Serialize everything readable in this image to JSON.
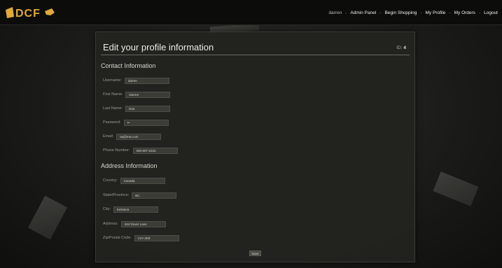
{
  "navbar": {
    "logo_text": "DCF",
    "user": "darren",
    "links": [
      "Admin Panel",
      "Begin Shopping",
      "My Profile",
      "My Orders",
      "Logout"
    ]
  },
  "panel": {
    "title": "Edit your profile information",
    "id_label": "ID:",
    "id_value": "4"
  },
  "contact": {
    "heading": "Contact Information",
    "fields": [
      {
        "label": "Username:",
        "value": "darren"
      },
      {
        "label": "First Name:",
        "value": "Darren"
      },
      {
        "label": "Last Name:",
        "value": "Doe"
      },
      {
        "label": "Password:",
        "value": "••"
      },
      {
        "label": "Email:",
        "value": "aa@mw.com"
      },
      {
        "label": "Phone Number:",
        "value": "250-807-2222"
      }
    ]
  },
  "address": {
    "heading": "Address Information",
    "fields": [
      {
        "label": "Country:",
        "value": "Canada"
      },
      {
        "label": "State/Province:",
        "value": "BC"
      },
      {
        "label": "City:",
        "value": "Kelowna"
      },
      {
        "label": "Address:",
        "value": "444 Dover Lane"
      },
      {
        "label": "Zip/Postal Code:",
        "value": "V1V 2K9"
      }
    ]
  },
  "save_label": "Save",
  "colors": {
    "background": "#1c1c1a",
    "navbar": "#0c0c0b",
    "logo": "#e0a93a",
    "panel": "#22221f"
  }
}
